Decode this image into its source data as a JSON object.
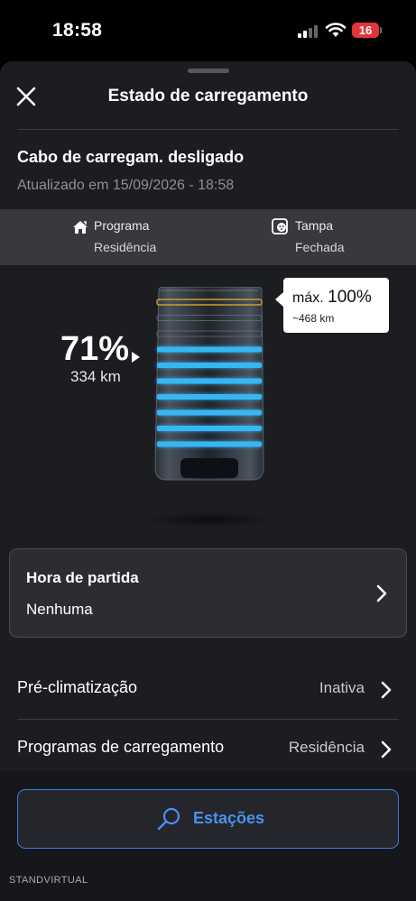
{
  "status_bar": {
    "time": "18:58",
    "battery_level": "16",
    "signal_icon": "cellular-signal-icon",
    "wifi_icon": "wifi-icon"
  },
  "header": {
    "title": "Estado de carregamento",
    "close_icon": "close-icon"
  },
  "status": {
    "cable": "Cabo de carregam. desligado",
    "updated": "Atualizado em 15/09/2026 - 18:58"
  },
  "info": {
    "program": {
      "label": "Programa",
      "value": "Residência",
      "icon": "home-icon"
    },
    "flap": {
      "label": "Tampa",
      "value": "Fechada",
      "icon": "charging-flap-icon"
    }
  },
  "charge": {
    "percent": "71%",
    "range": "334 km",
    "level_fraction": 0.71,
    "max_prefix": "máx.",
    "max_value": "100%",
    "max_range": "~468 km",
    "colors": {
      "bar": "#35b7f5",
      "limit": "#c9a227"
    }
  },
  "departure": {
    "title": "Hora de partida",
    "value": "Nenhuma"
  },
  "rows": [
    {
      "label": "Pré-climatização",
      "value": "Inativa"
    },
    {
      "label": "Programas de carregamento",
      "value": "Residência"
    }
  ],
  "actions": {
    "stations_label": "Estações",
    "stations_icon": "search-icon",
    "accent": "#3d7ddb"
  },
  "watermark": "STANDVIRTUAL"
}
